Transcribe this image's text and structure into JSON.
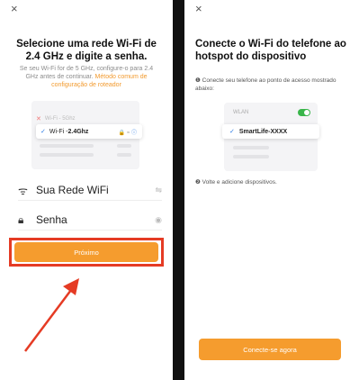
{
  "screen1": {
    "close_icon": "×",
    "title": "Selecione uma rede Wi-Fi de 2.4 GHz e digite a senha.",
    "desc": "Se seu Wi-Fi for de 5 GHz, configure-o para 2.4 GHz antes de continuar.",
    "desc_link": "Método comum de configuração de roteador",
    "row_5g": "Wi-Fi - 5Ghz",
    "row_24_prefix": "Wi-Fi - ",
    "row_24_value": "2.4Ghz",
    "ssid_value": "Sua Rede WiFi",
    "password_placeholder": "Senha",
    "next_button": "Próximo"
  },
  "screen2": {
    "close_icon": "×",
    "title": "Conecte o Wi-Fi do telefone ao hotspot do dispositivo",
    "desc": "Conecte seu telefone ao ponto de acesso mostrado abaixo:",
    "wlan_label": "WLAN",
    "hotspot_name": "SmartLife-XXXX",
    "back_text": "Volte e adicione dispositivos.",
    "connect_button": "Conecte-se agora"
  },
  "colors": {
    "accent": "#f59c2e",
    "highlight": "#e53b24",
    "check": "#2b7be4",
    "toggle_on": "#39b54a"
  },
  "icons": [
    "close-icon",
    "wifi-icon",
    "lock-icon",
    "eye-icon",
    "swap-icon",
    "check-icon",
    "info-icon"
  ]
}
